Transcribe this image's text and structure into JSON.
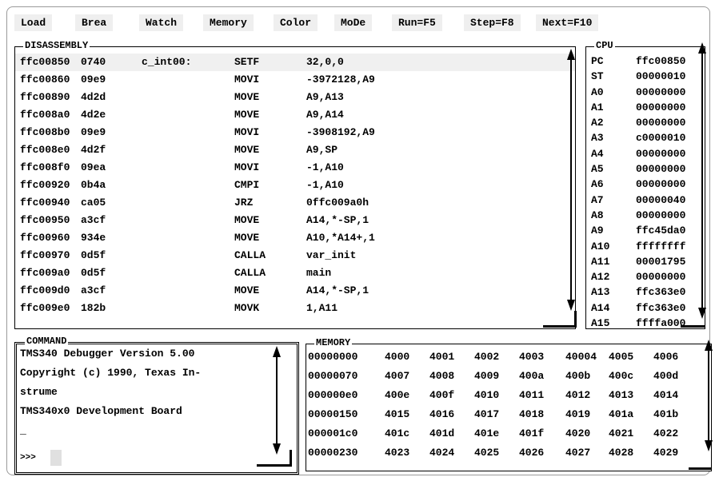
{
  "menu": {
    "items": [
      "Load",
      "Brea",
      "Watch",
      "Memory",
      "Color",
      "MoDe",
      "Run=F5",
      "Step=F8",
      "Next=F10"
    ]
  },
  "disassembly": {
    "title": "DISASSEMBLY",
    "rows": [
      {
        "addr": "ffc00850",
        "op": "0740",
        "label": "c_int00:",
        "mn": "SETF",
        "args": "32,0,0"
      },
      {
        "addr": "ffc00860",
        "op": "09e9",
        "label": "",
        "mn": "MOVI",
        "args": "-3972128,A9"
      },
      {
        "addr": "ffc00890",
        "op": "4d2d",
        "label": "",
        "mn": "MOVE",
        "args": "A9,A13"
      },
      {
        "addr": "ffc008a0",
        "op": "4d2e",
        "label": "",
        "mn": "MOVE",
        "args": "A9,A14"
      },
      {
        "addr": "ffc008b0",
        "op": "09e9",
        "label": "",
        "mn": "MOVI",
        "args": "-3908192,A9"
      },
      {
        "addr": "ffc008e0",
        "op": "4d2f",
        "label": "",
        "mn": "MOVE",
        "args": "A9,SP"
      },
      {
        "addr": "ffc008f0",
        "op": "09ea",
        "label": "",
        "mn": "MOVI",
        "args": "-1,A10"
      },
      {
        "addr": "ffc00920",
        "op": "0b4a",
        "label": "",
        "mn": "CMPI",
        "args": "-1,A10"
      },
      {
        "addr": "ffc00940",
        "op": "ca05",
        "label": "",
        "mn": "JRZ",
        "args": "0ffc009a0h"
      },
      {
        "addr": "ffc00950",
        "op": "a3cf",
        "label": "",
        "mn": "MOVE",
        "args": "A14,*-SP,1"
      },
      {
        "addr": "ffc00960",
        "op": "934e",
        "label": "",
        "mn": "MOVE",
        "args": "A10,*A14+,1"
      },
      {
        "addr": "ffc00970",
        "op": "0d5f",
        "label": "",
        "mn": "CALLA",
        "args": "var_init"
      },
      {
        "addr": "ffc009a0",
        "op": "0d5f",
        "label": "",
        "mn": "CALLA",
        "args": "main"
      },
      {
        "addr": "ffc009d0",
        "op": "a3cf",
        "label": "",
        "mn": "MOVE",
        "args": "A14,*-SP,1"
      },
      {
        "addr": "ffc009e0",
        "op": "182b",
        "label": "",
        "mn": "MOVK",
        "args": "1,A11"
      }
    ]
  },
  "cpu": {
    "title": "CPU",
    "regs": [
      {
        "name": "PC",
        "val": "ffc00850"
      },
      {
        "name": "ST",
        "val": "00000010"
      },
      {
        "name": "A0",
        "val": "00000000"
      },
      {
        "name": "A1",
        "val": "00000000"
      },
      {
        "name": "A2",
        "val": "00000000"
      },
      {
        "name": "A3",
        "val": "c0000010"
      },
      {
        "name": "A4",
        "val": "00000000"
      },
      {
        "name": "A5",
        "val": "00000000"
      },
      {
        "name": "A6",
        "val": "00000000"
      },
      {
        "name": "A7",
        "val": "00000040"
      },
      {
        "name": "A8",
        "val": "00000000"
      },
      {
        "name": "A9",
        "val": "ffc45da0"
      },
      {
        "name": "A10",
        "val": "ffffffff"
      },
      {
        "name": "A11",
        "val": "00001795"
      },
      {
        "name": "A12",
        "val": "00000000"
      },
      {
        "name": "A13",
        "val": "ffc363e0"
      },
      {
        "name": "A14",
        "val": "ffc363e0"
      },
      {
        "name": "A15",
        "val": "ffffa000"
      }
    ]
  },
  "command": {
    "title": "COMMAND",
    "lines": [
      "TMS340 Debugger Version 5.00",
      "Copyright (c) 1990, Texas In-",
      "strume",
      "TMS340x0 Development Board",
      "_"
    ],
    "prompt": ">>>"
  },
  "memory": {
    "title": "MEMORY",
    "rows": [
      {
        "addr": "00000000",
        "vals": [
          "4000",
          "4001",
          "4002",
          "4003",
          "40004",
          "4005",
          "4006"
        ]
      },
      {
        "addr": "00000070",
        "vals": [
          "4007",
          "4008",
          "4009",
          "400a",
          "400b",
          "400c",
          "400d"
        ]
      },
      {
        "addr": "000000e0",
        "vals": [
          "400e",
          "400f",
          "4010",
          "4011",
          "4012",
          "4013",
          "4014"
        ]
      },
      {
        "addr": "00000150",
        "vals": [
          "4015",
          "4016",
          "4017",
          "4018",
          "4019",
          "401a",
          "401b"
        ]
      },
      {
        "addr": "000001c0",
        "vals": [
          "401c",
          "401d",
          "401e",
          "401f",
          "4020",
          "4021",
          "4022"
        ]
      },
      {
        "addr": "00000230",
        "vals": [
          "4023",
          "4024",
          "4025",
          "4026",
          "4027",
          "4028",
          "4029"
        ]
      }
    ]
  }
}
